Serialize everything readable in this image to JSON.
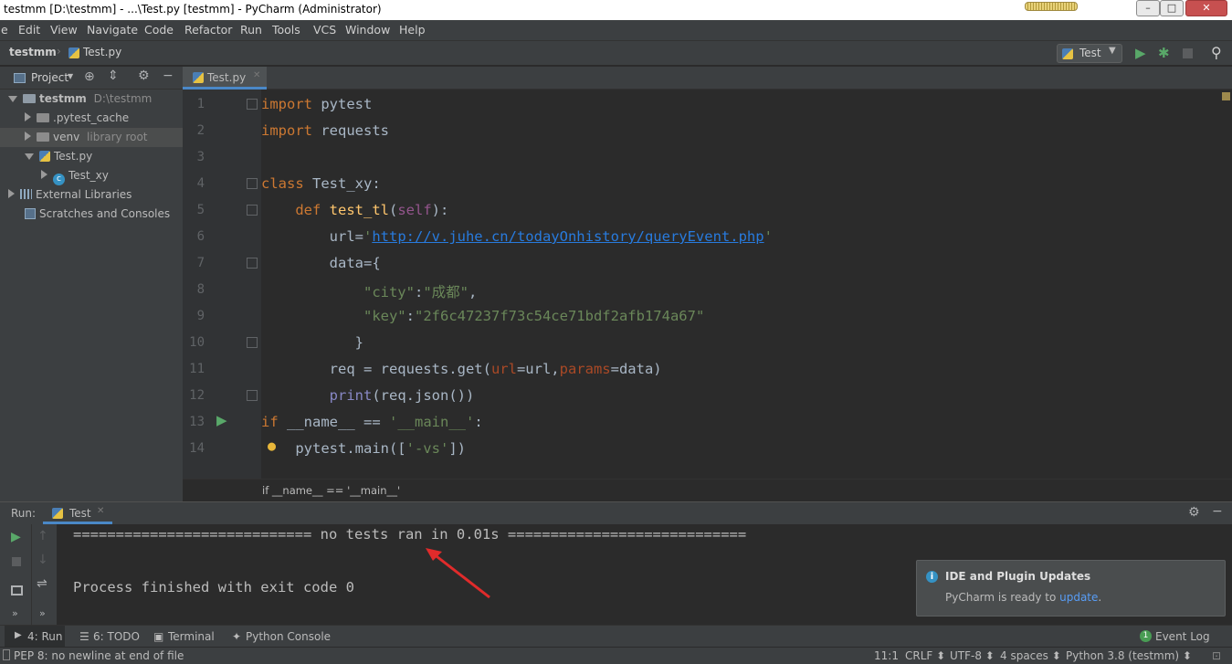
{
  "window": {
    "title": "testmm [D:\\testmm] - ...\\Test.py [testmm] - PyCharm (Administrator)",
    "min_label": "–",
    "max_label": "□",
    "close_label": "✕"
  },
  "menu": [
    "e",
    "Edit",
    "View",
    "Navigate",
    "Code",
    "Refactor",
    "Run",
    "Tools",
    "VCS",
    "Window",
    "Help"
  ],
  "nav": {
    "project": "testmm",
    "file": "Test.py",
    "run_config": "Test"
  },
  "project_panel": {
    "header": "Project",
    "tree": [
      {
        "label": "testmm",
        "hint": "D:\\testmm"
      },
      {
        "label": ".pytest_cache",
        "hint": ""
      },
      {
        "label": "venv",
        "hint": "library root"
      },
      {
        "label": "Test.py",
        "hint": ""
      },
      {
        "label": "Test_xy",
        "hint": ""
      },
      {
        "label": "External Libraries",
        "hint": ""
      },
      {
        "label": "Scratches and Consoles",
        "hint": ""
      }
    ]
  },
  "editor": {
    "tab": "Test.py",
    "line_numbers": [
      "1",
      "2",
      "3",
      "4",
      "5",
      "6",
      "7",
      "8",
      "9",
      "10",
      "11",
      "12",
      "13",
      "14"
    ],
    "breadcrumb": "if __name__ == '__main__'"
  },
  "run_panel": {
    "label": "Run:",
    "tab": "Test",
    "console_line1": "============================ no tests ran in 0.01s ============================",
    "console_line2": "Process finished with exit code 0"
  },
  "notification": {
    "title": "IDE and Plugin Updates",
    "body_prefix": "PyCharm is ready to ",
    "link": "update",
    "body_suffix": "."
  },
  "tool_tabs": {
    "run": "4: Run",
    "todo": "6: TODO",
    "terminal": "Terminal",
    "python_console": "Python Console",
    "event_log": "Event Log",
    "event_count": "1"
  },
  "status": {
    "message": "PEP 8: no newline at end of file",
    "position": "11:1",
    "line_sep": "CRLF ⬍",
    "encoding": "UTF-8 ⬍",
    "indent": "4 spaces ⬍",
    "interpreter": "Python 3.8 (testmm) ⬍"
  },
  "colors": {
    "keyword": "#cc7832",
    "string": "#6a8759",
    "function": "#ffc66d",
    "link": "#287bde",
    "accent": "#4a88c7"
  }
}
